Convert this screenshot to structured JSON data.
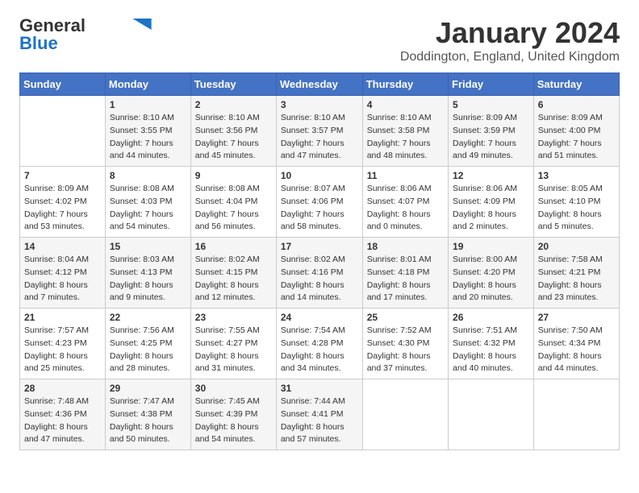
{
  "logo": {
    "general": "General",
    "blue": "Blue"
  },
  "title": "January 2024",
  "location": "Doddington, England, United Kingdom",
  "days_header": [
    "Sunday",
    "Monday",
    "Tuesday",
    "Wednesday",
    "Thursday",
    "Friday",
    "Saturday"
  ],
  "weeks": [
    [
      {
        "day": "",
        "info": ""
      },
      {
        "day": "1",
        "info": "Sunrise: 8:10 AM\nSunset: 3:55 PM\nDaylight: 7 hours\nand 44 minutes."
      },
      {
        "day": "2",
        "info": "Sunrise: 8:10 AM\nSunset: 3:56 PM\nDaylight: 7 hours\nand 45 minutes."
      },
      {
        "day": "3",
        "info": "Sunrise: 8:10 AM\nSunset: 3:57 PM\nDaylight: 7 hours\nand 47 minutes."
      },
      {
        "day": "4",
        "info": "Sunrise: 8:10 AM\nSunset: 3:58 PM\nDaylight: 7 hours\nand 48 minutes."
      },
      {
        "day": "5",
        "info": "Sunrise: 8:09 AM\nSunset: 3:59 PM\nDaylight: 7 hours\nand 49 minutes."
      },
      {
        "day": "6",
        "info": "Sunrise: 8:09 AM\nSunset: 4:00 PM\nDaylight: 7 hours\nand 51 minutes."
      }
    ],
    [
      {
        "day": "7",
        "info": "Sunrise: 8:09 AM\nSunset: 4:02 PM\nDaylight: 7 hours\nand 53 minutes."
      },
      {
        "day": "8",
        "info": "Sunrise: 8:08 AM\nSunset: 4:03 PM\nDaylight: 7 hours\nand 54 minutes."
      },
      {
        "day": "9",
        "info": "Sunrise: 8:08 AM\nSunset: 4:04 PM\nDaylight: 7 hours\nand 56 minutes."
      },
      {
        "day": "10",
        "info": "Sunrise: 8:07 AM\nSunset: 4:06 PM\nDaylight: 7 hours\nand 58 minutes."
      },
      {
        "day": "11",
        "info": "Sunrise: 8:06 AM\nSunset: 4:07 PM\nDaylight: 8 hours\nand 0 minutes."
      },
      {
        "day": "12",
        "info": "Sunrise: 8:06 AM\nSunset: 4:09 PM\nDaylight: 8 hours\nand 2 minutes."
      },
      {
        "day": "13",
        "info": "Sunrise: 8:05 AM\nSunset: 4:10 PM\nDaylight: 8 hours\nand 5 minutes."
      }
    ],
    [
      {
        "day": "14",
        "info": "Sunrise: 8:04 AM\nSunset: 4:12 PM\nDaylight: 8 hours\nand 7 minutes."
      },
      {
        "day": "15",
        "info": "Sunrise: 8:03 AM\nSunset: 4:13 PM\nDaylight: 8 hours\nand 9 minutes."
      },
      {
        "day": "16",
        "info": "Sunrise: 8:02 AM\nSunset: 4:15 PM\nDaylight: 8 hours\nand 12 minutes."
      },
      {
        "day": "17",
        "info": "Sunrise: 8:02 AM\nSunset: 4:16 PM\nDaylight: 8 hours\nand 14 minutes."
      },
      {
        "day": "18",
        "info": "Sunrise: 8:01 AM\nSunset: 4:18 PM\nDaylight: 8 hours\nand 17 minutes."
      },
      {
        "day": "19",
        "info": "Sunrise: 8:00 AM\nSunset: 4:20 PM\nDaylight: 8 hours\nand 20 minutes."
      },
      {
        "day": "20",
        "info": "Sunrise: 7:58 AM\nSunset: 4:21 PM\nDaylight: 8 hours\nand 23 minutes."
      }
    ],
    [
      {
        "day": "21",
        "info": "Sunrise: 7:57 AM\nSunset: 4:23 PM\nDaylight: 8 hours\nand 25 minutes."
      },
      {
        "day": "22",
        "info": "Sunrise: 7:56 AM\nSunset: 4:25 PM\nDaylight: 8 hours\nand 28 minutes."
      },
      {
        "day": "23",
        "info": "Sunrise: 7:55 AM\nSunset: 4:27 PM\nDaylight: 8 hours\nand 31 minutes."
      },
      {
        "day": "24",
        "info": "Sunrise: 7:54 AM\nSunset: 4:28 PM\nDaylight: 8 hours\nand 34 minutes."
      },
      {
        "day": "25",
        "info": "Sunrise: 7:52 AM\nSunset: 4:30 PM\nDaylight: 8 hours\nand 37 minutes."
      },
      {
        "day": "26",
        "info": "Sunrise: 7:51 AM\nSunset: 4:32 PM\nDaylight: 8 hours\nand 40 minutes."
      },
      {
        "day": "27",
        "info": "Sunrise: 7:50 AM\nSunset: 4:34 PM\nDaylight: 8 hours\nand 44 minutes."
      }
    ],
    [
      {
        "day": "28",
        "info": "Sunrise: 7:48 AM\nSunset: 4:36 PM\nDaylight: 8 hours\nand 47 minutes."
      },
      {
        "day": "29",
        "info": "Sunrise: 7:47 AM\nSunset: 4:38 PM\nDaylight: 8 hours\nand 50 minutes."
      },
      {
        "day": "30",
        "info": "Sunrise: 7:45 AM\nSunset: 4:39 PM\nDaylight: 8 hours\nand 54 minutes."
      },
      {
        "day": "31",
        "info": "Sunrise: 7:44 AM\nSunset: 4:41 PM\nDaylight: 8 hours\nand 57 minutes."
      },
      {
        "day": "",
        "info": ""
      },
      {
        "day": "",
        "info": ""
      },
      {
        "day": "",
        "info": ""
      }
    ]
  ]
}
